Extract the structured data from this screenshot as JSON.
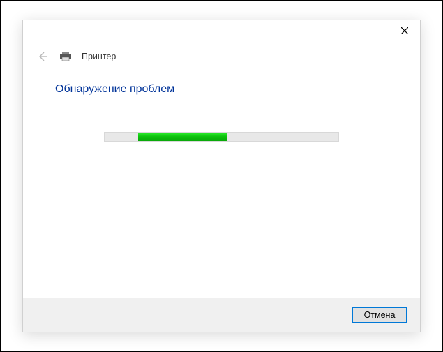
{
  "header": {
    "breadcrumb": "Принтер"
  },
  "main": {
    "heading": "Обнаружение проблем"
  },
  "footer": {
    "cancel_label": "Отмена"
  },
  "colors": {
    "heading": "#003399",
    "accent": "#0078d7",
    "progress": "#0aa80a"
  },
  "progress": {
    "indeterminate": true
  }
}
